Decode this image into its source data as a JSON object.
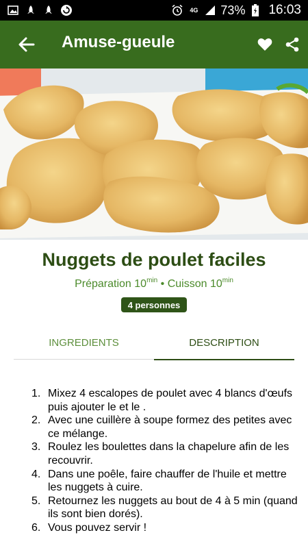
{
  "status_bar": {
    "icons_left": [
      "gallery-icon",
      "rocket-icon",
      "rocket-icon",
      "sync-icon"
    ],
    "network": "4G",
    "battery": "73%",
    "time": "16:03"
  },
  "app_bar": {
    "title": "Amuse-gueule",
    "color": "#386c1e"
  },
  "recipe": {
    "title": "Nuggets de poulet faciles",
    "prep_label": "Préparation 10",
    "prep_unit": "min",
    "separator": "•",
    "cook_label": "Cuisson 10",
    "cook_unit": "min",
    "servings": "4 personnes"
  },
  "tabs": {
    "ingredients": "INGREDIENTS",
    "description": "DESCRIPTION",
    "active": "description"
  },
  "steps": [
    {
      "num": "1.",
      "text": "Mixez 4 escalopes de poulet avec 4 blancs d'œufs puis ajouter le et le ."
    },
    {
      "num": "2.",
      "text": "Avec une cuillère à soupe formez des petites avec ce mélange."
    },
    {
      "num": "3.",
      "text": "Roulez les boulettes dans la chapelure afin de les recouvrir."
    },
    {
      "num": "4.",
      "text": "Dans une poêle, faire chauffer de l'huile et mettre les nuggets à cuire."
    },
    {
      "num": "5.",
      "text": "Retournez les nuggets au bout de 4 à 5 min (quand ils sont bien dorés)."
    },
    {
      "num": "6.",
      "text": "Vous pouvez servir !"
    }
  ]
}
